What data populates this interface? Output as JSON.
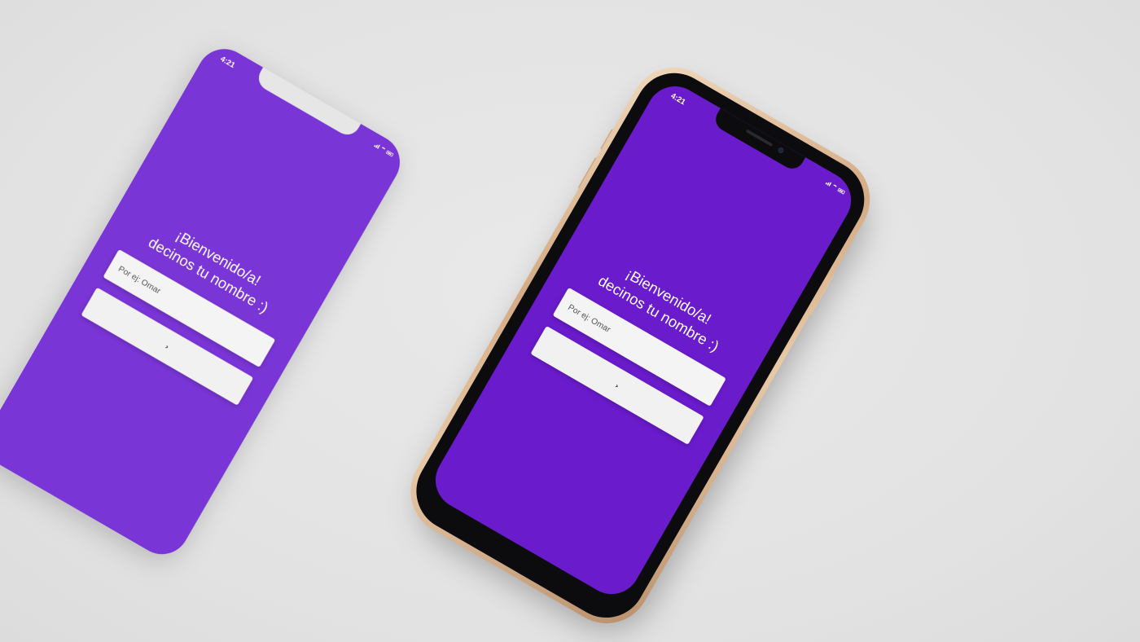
{
  "colors": {
    "background": "#e4e4e4",
    "screen_front": "#6a1bcc",
    "screen_back": "#7a35d6",
    "frame_gold": "#d4ab85",
    "input_bg": "#f4f4f4"
  },
  "status_bar": {
    "time": "4:21",
    "icons": [
      "signal-icon",
      "wifi-icon",
      "battery-icon"
    ]
  },
  "welcome": {
    "line1": "¡Bienvenido/a!",
    "line2": "decinos tu nombre :)"
  },
  "name_input": {
    "value": "",
    "placeholder": "Por ej: Omar"
  },
  "next_button": {
    "icon": "chevron-right-icon",
    "glyph": "›"
  }
}
